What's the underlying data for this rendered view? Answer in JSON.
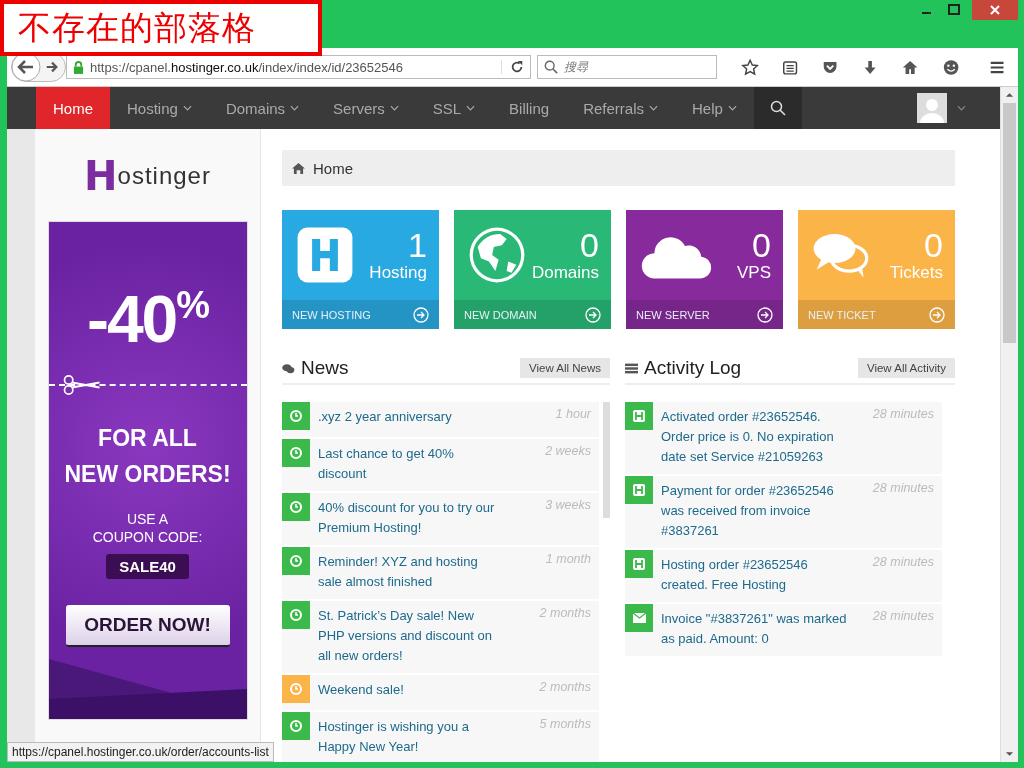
{
  "annotation": {
    "text": "不存在的部落格"
  },
  "browser": {
    "url": "https://cpanel.**hostinger.co.uk**/index/index/id/23652546",
    "search": {
      "placeholder": "搜尋"
    }
  },
  "nav": {
    "items": [
      {
        "label": "Home",
        "selected": true,
        "has_menu": false
      },
      {
        "label": "Hosting",
        "selected": false,
        "has_menu": true
      },
      {
        "label": "Domains",
        "selected": false,
        "has_menu": true
      },
      {
        "label": "Servers",
        "selected": false,
        "has_menu": true
      },
      {
        "label": "SSL",
        "selected": false,
        "has_menu": true
      },
      {
        "label": "Billing",
        "selected": false,
        "has_menu": false
      },
      {
        "label": "Referrals",
        "selected": false,
        "has_menu": true
      },
      {
        "label": "Help",
        "selected": false,
        "has_menu": true
      }
    ]
  },
  "sidebar": {
    "logo": {
      "initial": "H",
      "rest": "ostinger"
    },
    "banner": {
      "discount": "-40",
      "percent": "%",
      "headline": [
        "FOR ALL",
        "NEW ORDERS!"
      ],
      "coupon_lines": [
        "USE A",
        "COUPON CODE:"
      ],
      "code": "SALE40",
      "button": "ORDER NOW!"
    }
  },
  "breadcrumb": {
    "label": "Home"
  },
  "tiles": [
    {
      "kind": "hosting",
      "count": "1",
      "label": "Hosting",
      "action": "NEW HOSTING",
      "color": "#29a9e1"
    },
    {
      "kind": "domains",
      "count": "0",
      "label": "Domains",
      "action": "NEW DOMAIN",
      "color": "#2ab877"
    },
    {
      "kind": "vps",
      "count": "0",
      "label": "VPS",
      "action": "NEW SERVER",
      "color": "#872b9c"
    },
    {
      "kind": "tickets",
      "count": "0",
      "label": "Tickets",
      "action": "NEW TICKET",
      "color": "#fbb448"
    }
  ],
  "news": {
    "title": "News",
    "button": "View All News",
    "items": [
      {
        "text": ".xyz 2 year anniversary",
        "time": "1 hour",
        "color": "#3cb94b"
      },
      {
        "text": "Last chance to get 40% discount",
        "time": "2 weeks",
        "color": "#3cb94b"
      },
      {
        "text": "40% discount for you to try our Premium Hosting!",
        "time": "3 weeks",
        "color": "#3cb94b"
      },
      {
        "text": "Reminder! XYZ and hosting sale almost finished",
        "time": "1 month",
        "color": "#3cb94b"
      },
      {
        "text": "St. Patrick’s Day sale! New PHP versions and discount on all new orders!",
        "time": "2 months",
        "color": "#3cb94b"
      },
      {
        "text": "Weekend sale!",
        "time": "2 months",
        "color": "#fbb448"
      },
      {
        "text": "Hostinger is wishing you a Happy New Year!",
        "time": "5 months",
        "color": "#3cb94b"
      }
    ]
  },
  "activity": {
    "title": "Activity Log",
    "button": "View All Activity",
    "items": [
      {
        "kind": "hosting",
        "text": "Activated order #23652546. Order price is 0. No expiration date set Service #21059263",
        "time": "28 minutes"
      },
      {
        "kind": "hosting",
        "text": "Payment for order #23652546 was received from invoice #3837261",
        "time": "28 minutes"
      },
      {
        "kind": "hosting",
        "text": "Hosting order #23652546 created. Free Hosting",
        "time": "28 minutes"
      },
      {
        "kind": "invoice",
        "text": "Invoice \"#3837261\" was marked as paid. Amount: 0",
        "time": "28 minutes"
      }
    ]
  },
  "status_bar": {
    "url": "https://cpanel.hostinger.co.uk/order/accounts-list"
  }
}
